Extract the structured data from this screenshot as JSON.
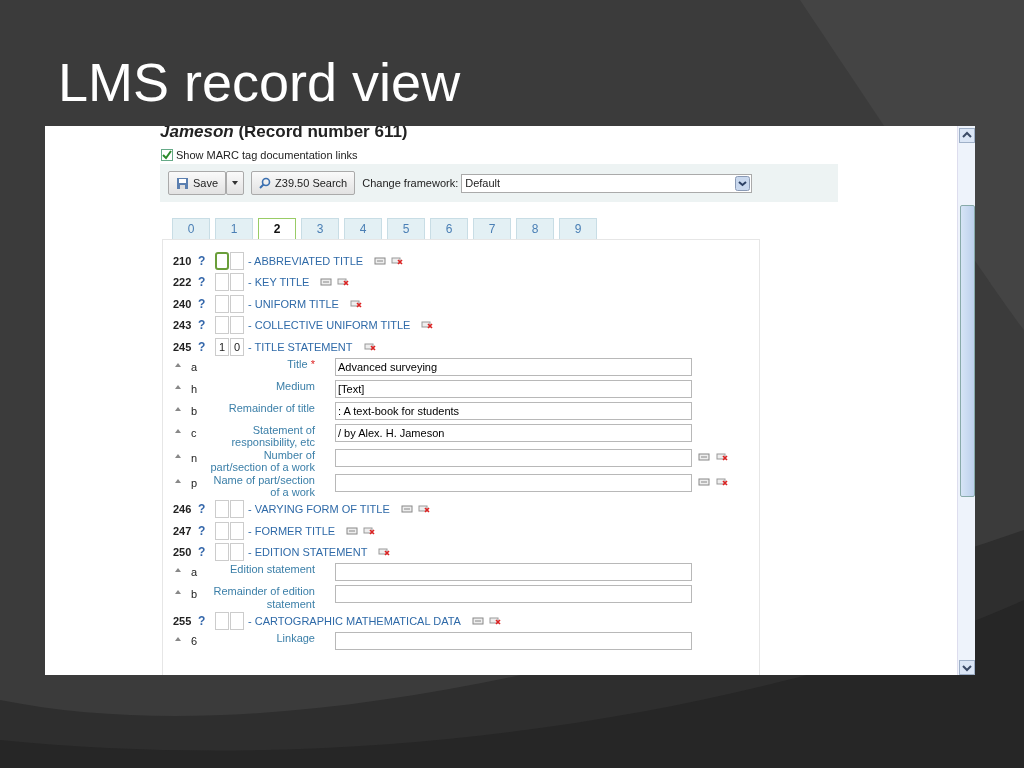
{
  "slide": {
    "title": "LMS record view"
  },
  "required_mark": "*",
  "record": {
    "heading": "*Jameson* (Record number 611)"
  },
  "show_docs": {
    "label": "Show MARC tag documentation links",
    "checked": true
  },
  "toolbar": {
    "save": "Save",
    "search": "Z39.50 Search",
    "framework_label": "Change framework:",
    "framework_value": "Default"
  },
  "tabs": [
    {
      "label": "0",
      "selected": false
    },
    {
      "label": "1",
      "selected": false
    },
    {
      "label": "2",
      "selected": true
    },
    {
      "label": "3",
      "selected": false
    },
    {
      "label": "4",
      "selected": false
    },
    {
      "label": "5",
      "selected": false
    },
    {
      "label": "6",
      "selected": false
    },
    {
      "label": "7",
      "selected": false
    },
    {
      "label": "8",
      "selected": false
    },
    {
      "label": "9",
      "selected": false
    }
  ],
  "fields": [
    {
      "tag": "210",
      "help": "?",
      "indicators": [
        {
          "focused": true
        },
        {
          "focused": false
        }
      ],
      "name": "- ABBREVIATED TITLE",
      "repeatable": true
    },
    {
      "tag": "222",
      "help": "?",
      "indicators": [
        {
          "focused": false
        },
        {
          "focused": false
        }
      ],
      "name": "- KEY TITLE",
      "repeatable": true
    },
    {
      "tag": "240",
      "help": "?",
      "indicators": [
        {
          "focused": false
        },
        {
          "focused": false
        }
      ],
      "name": "- UNIFORM TITLE",
      "repeatable": false
    },
    {
      "tag": "243",
      "help": "?",
      "indicators": [
        {
          "focused": false
        },
        {
          "focused": false
        }
      ],
      "name": "- COLLECTIVE UNIFORM TITLE",
      "repeatable": false
    },
    {
      "tag": "245",
      "help": "?",
      "indicators": [
        {
          "value": "1",
          "focused": false
        },
        {
          "value": "0",
          "focused": false
        }
      ],
      "name": "- TITLE STATEMENT",
      "repeatable": false,
      "subfields": [
        {
          "code": "a",
          "label": "Title",
          "required": true,
          "value": "Advanced surveying",
          "repeatable": false
        },
        {
          "code": "h",
          "label": "Medium",
          "required": false,
          "value": "[Text]",
          "repeatable": false
        },
        {
          "code": "b",
          "label": "Remainder of title",
          "required": false,
          "value": ": A text-book for students",
          "repeatable": false
        },
        {
          "code": "c",
          "label": "Statement of responsibility, etc",
          "required": false,
          "value": "/ by Alex. H. Jameson",
          "repeatable": false
        },
        {
          "code": "n",
          "label": "Number of part/section of a work",
          "required": false,
          "repeatable": true
        },
        {
          "code": "p",
          "label": "Name of part/section of a work",
          "required": false,
          "repeatable": true
        }
      ]
    },
    {
      "tag": "246",
      "help": "?",
      "indicators": [
        {
          "focused": false
        },
        {
          "focused": false
        }
      ],
      "name": "- VARYING FORM OF TITLE",
      "repeatable": true
    },
    {
      "tag": "247",
      "help": "?",
      "indicators": [
        {
          "focused": false
        },
        {
          "focused": false
        }
      ],
      "name": "- FORMER TITLE",
      "repeatable": true
    },
    {
      "tag": "250",
      "help": "?",
      "indicators": [
        {
          "focused": false
        },
        {
          "focused": false
        }
      ],
      "name": "- EDITION STATEMENT",
      "repeatable": false,
      "subfields": [
        {
          "code": "a",
          "label": "Edition statement",
          "required": false,
          "repeatable": false
        },
        {
          "code": "b",
          "label": "Remainder of edition statement",
          "required": false,
          "repeatable": false
        }
      ]
    },
    {
      "tag": "255",
      "help": "?",
      "indicators": [
        {
          "focused": false
        },
        {
          "focused": false
        }
      ],
      "name": "- CARTOGRAPHIC MATHEMATICAL DATA",
      "repeatable": true,
      "subfields": [
        {
          "code": "6",
          "label": "Linkage",
          "required": false,
          "repeatable": false
        }
      ]
    }
  ]
}
